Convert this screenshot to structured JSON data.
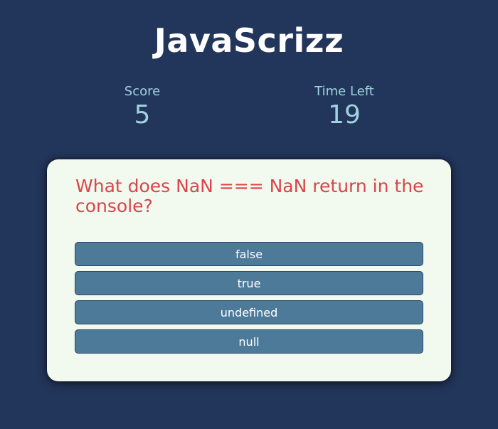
{
  "header": {
    "title": "JavaScrizz"
  },
  "stats": {
    "score_label": "Score",
    "score_value": "5",
    "time_label": "Time Left",
    "time_value": "19"
  },
  "quiz": {
    "question": "What does NaN === NaN return in the console?",
    "answers": [
      "false",
      "true",
      "undefined",
      "null"
    ]
  },
  "colors": {
    "background": "#22355a",
    "card": "#f2f9ef",
    "question_text": "#d9454a",
    "answer_button": "#4e7a9a",
    "stat_text": "#9fd2dd"
  }
}
